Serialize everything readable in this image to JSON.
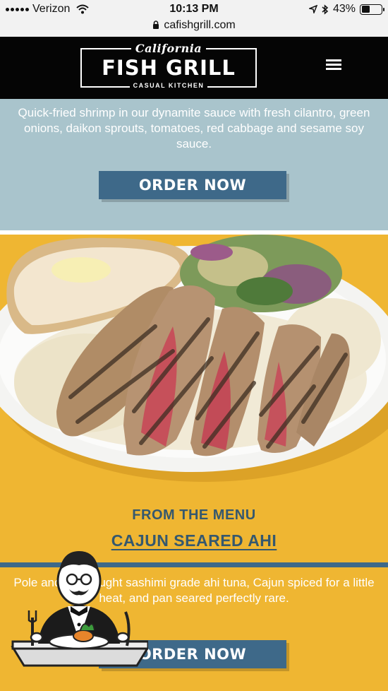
{
  "status_bar": {
    "carrier": "Verizon",
    "time": "10:13 PM",
    "battery": "43%",
    "battery_level": 0.43,
    "url": "cafishgrill.com"
  },
  "header": {
    "logo_script": "California",
    "logo_main": "FISH GRILL",
    "logo_sub": "CASUAL KITCHEN"
  },
  "prev_item": {
    "description": "Quick-fried shrimp in our dynamite sauce with fresh cilantro, green onions, daikon sprouts, tomatoes, red cabbage and sesame soy sauce.",
    "order_label": "ORDER NOW"
  },
  "featured": {
    "section_label": "FROM THE MENU",
    "title": "CAJUN SEARED AHI",
    "description": "Pole and line caught sashimi grade ahi tuna, Cajun spiced for a little heat, and pan seared perfectly rare.",
    "order_label": "ORDER NOW"
  },
  "colors": {
    "header_bg": "#050505",
    "blue_section": "#a9c4cc",
    "yellow_section": "#efb632",
    "button": "#3e6989",
    "title_text": "#35586e"
  },
  "icons": [
    "signal-icon",
    "wifi-icon",
    "location-arrow-icon",
    "bluetooth-icon",
    "battery-icon",
    "lock-icon",
    "hamburger-menu-icon",
    "waiter-icon"
  ]
}
